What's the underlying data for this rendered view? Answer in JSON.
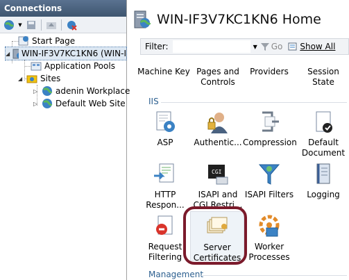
{
  "connections": {
    "title": "Connections",
    "tree": [
      {
        "label": "Start Page"
      },
      {
        "label": "WIN-IF3V7KC1KN6 (WIN-I"
      },
      {
        "label": "Application Pools"
      },
      {
        "label": "Sites"
      },
      {
        "label": "adenin Workplace"
      },
      {
        "label": "Default Web Site"
      }
    ]
  },
  "main": {
    "title": "WIN-IF3V7KC1KN6 Home",
    "filter": {
      "label": "Filter:",
      "value": "",
      "go_label": "Go",
      "show_all_label": "Show All"
    },
    "top_row": [
      "Machine Key",
      "Pages and Controls",
      "Providers",
      "Session State"
    ],
    "section_iis": "IIS",
    "iis_row1": [
      "ASP",
      "Authentic...",
      "Compression",
      "Default Document"
    ],
    "iis_row2": [
      "HTTP Respon...",
      "ISAPI and CGI Restri...",
      "ISAPI Filters",
      "Logging"
    ],
    "iis_row3": [
      "Request Filtering",
      "Server Certificates",
      "Worker Processes"
    ],
    "section_management": "Management"
  },
  "colors": {
    "highlight_ring": "#7b1a2b",
    "title_bar": "#4a6280"
  }
}
